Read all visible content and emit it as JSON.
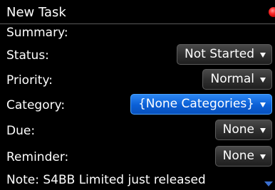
{
  "title": "New Task",
  "colors": {
    "selected_accent": "#0a5fd6",
    "status_dot": "#ff2a2a",
    "background": "#000000"
  },
  "form": {
    "summary_label": "Summary:",
    "summary_value": "",
    "status_label": "Status:",
    "status_value": "Not Started",
    "priority_label": "Priority:",
    "priority_value": "Normal",
    "category_label": "Category:",
    "category_value": "{None Categories}",
    "due_label": "Due:",
    "due_value": "None",
    "reminder_label": "Reminder:",
    "reminder_value": "None"
  },
  "note": "Note: S4BB Limited just released",
  "icons": {
    "status": "red-dot-icon",
    "scroll": "scroll-down-arrow-icon",
    "dropdown": "dropdown-caret-icon"
  }
}
